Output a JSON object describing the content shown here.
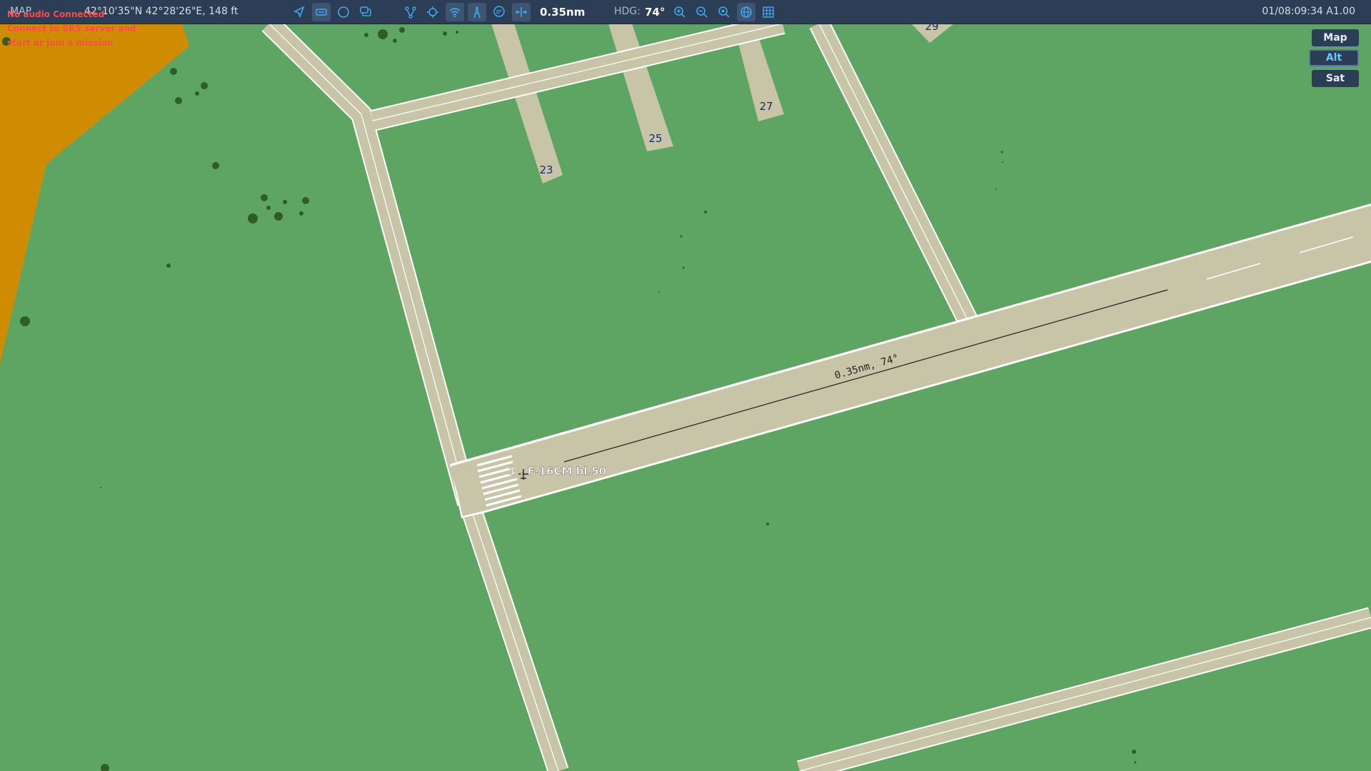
{
  "header": {
    "mode": "MAP",
    "coords": "42°10'35\"N 42°28'26\"E, 148 ft",
    "distance": "0.35nm",
    "hdg_label": "HDG:",
    "hdg_value": "74°",
    "time": "01/08:09:34 A1.00"
  },
  "warnings": {
    "radio": "No audio Connected",
    "line2": "Connect to SRS server and",
    "line3": "start or join a mission"
  },
  "toolbar_icons": [
    "navigate-arrow-icon",
    "keyboard-icon",
    "circle-icon",
    "layers-icon",
    "waypoints-icon",
    "crosshair-icon",
    "wifi-icon",
    "radio-tower-icon",
    "chat-icon",
    "split-arrows-icon",
    "zoom-in-icon",
    "zoom-out-icon",
    "zoom-fit-icon",
    "globe-icon",
    "grid-icon"
  ],
  "map": {
    "parking_labels": [
      "23",
      "25",
      "27",
      "29"
    ],
    "measure_label": "0.35nm, 74°",
    "aircraft_label": "1 . F-16CM bl.50"
  },
  "layers": {
    "map": "Map",
    "alt": "Alt",
    "sat": "Sat",
    "active": "Alt"
  },
  "colors": {
    "grass": "#5ea564",
    "pavement": "#c8c4a8",
    "terrain": "#d08c00",
    "topbar": "#2c3e55",
    "warning": "#ff4b4b",
    "accent": "#6ac6ff"
  }
}
